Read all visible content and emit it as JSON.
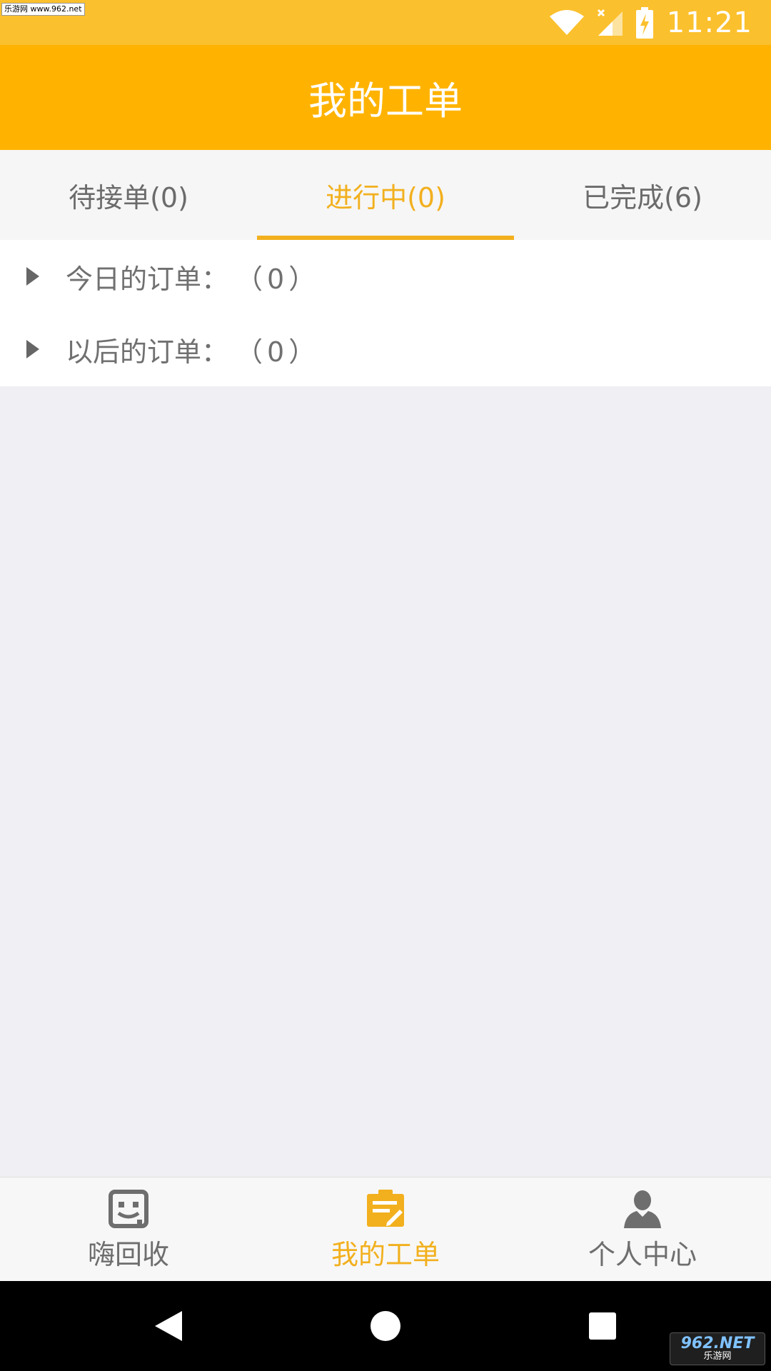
{
  "status_bar": {
    "time": "11:21",
    "watermark": "乐游网 www.962.net"
  },
  "header": {
    "title": "我的工单"
  },
  "tabs": [
    {
      "label": "待接单(0)",
      "active": false
    },
    {
      "label": "进行中(0)",
      "active": true
    },
    {
      "label": "已完成(6)",
      "active": false
    }
  ],
  "groups": [
    {
      "label": "今日的订单：",
      "count": "（0）"
    },
    {
      "label": "以后的订单：",
      "count": "（0）"
    }
  ],
  "bottom_nav": [
    {
      "label": "嗨回收",
      "icon": "robot-face-icon",
      "active": false
    },
    {
      "label": "我的工单",
      "icon": "clipboard-edit-icon",
      "active": true
    },
    {
      "label": "个人中心",
      "icon": "person-icon",
      "active": false
    }
  ],
  "system_nav": {
    "buttons": [
      "back-icon",
      "home-icon",
      "recents-icon"
    ]
  },
  "watermark": {
    "big": "962.NET",
    "small": "乐游网"
  },
  "colors": {
    "accent": "#ffb300",
    "status_bar": "#fbc02d",
    "active_text": "#f2b01e",
    "inactive_text": "#6b6b6b",
    "background": "#efeff4"
  }
}
